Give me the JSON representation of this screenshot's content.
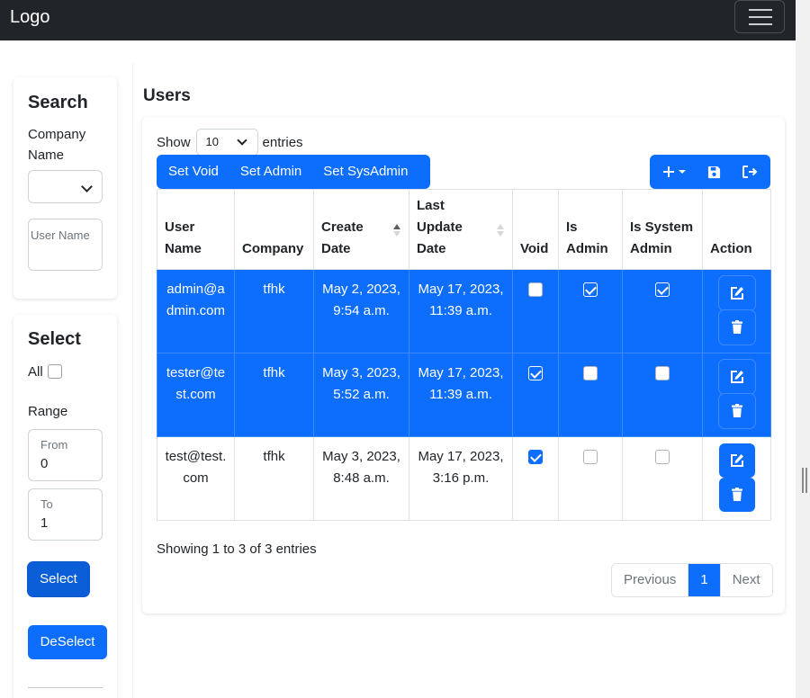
{
  "navbar": {
    "logo": "Logo"
  },
  "search": {
    "title": "Search",
    "company_label": "Company Name",
    "company_value": "",
    "user_name_placeholder": "User Name"
  },
  "select_panel": {
    "title": "Select",
    "all_label": "All",
    "range_label": "Range",
    "from_label": "From",
    "from_value": "0",
    "to_label": "To",
    "to_value": "1",
    "select_button": "Select",
    "deselect_button": "DeSelect"
  },
  "main": {
    "title": "Users",
    "show_label": "Show",
    "entries_value": "10",
    "entries_label": "entries",
    "buttons": {
      "set_void": "Set Void",
      "set_admin": "Set Admin",
      "set_sysadmin": "Set SysAdmin"
    },
    "columns": [
      "User Name",
      "Company",
      "Create Date",
      "Last Update Date",
      "Void",
      "Is Admin",
      "Is System Admin",
      "Action"
    ],
    "rows": [
      {
        "user_name": "admin@admin.com",
        "company": "tfhk",
        "create_date": "May 2, 2023, 9:54 a.m.",
        "last_update": "May 17, 2023, 11:39 a.m.",
        "void": false,
        "is_admin": true,
        "is_sysadmin": true,
        "selected": true
      },
      {
        "user_name": "tester@test.com",
        "company": "tfhk",
        "create_date": "May 3, 2023, 5:52 a.m.",
        "last_update": "May 17, 2023, 11:39 a.m.",
        "void": true,
        "is_admin": false,
        "is_sysadmin": false,
        "selected": true
      },
      {
        "user_name": "test@test.com",
        "company": "tfhk",
        "create_date": "May 3, 2023, 8:48 a.m.",
        "last_update": "May 17, 2023, 3:16 p.m.",
        "void": true,
        "is_admin": false,
        "is_sysadmin": false,
        "selected": false
      }
    ],
    "info": "Showing 1 to 3 of 3 entries",
    "pagination": {
      "previous": "Previous",
      "current": "1",
      "next": "Next"
    }
  },
  "colors": {
    "primary": "#0d6efd",
    "navbar": "#212529"
  },
  "icons": [
    "hamburger-icon",
    "plus-icon",
    "caret-down-icon",
    "save-icon",
    "logout-icon",
    "edit-icon",
    "trash-icon",
    "sort-asc-icon",
    "sort-both-icon"
  ]
}
